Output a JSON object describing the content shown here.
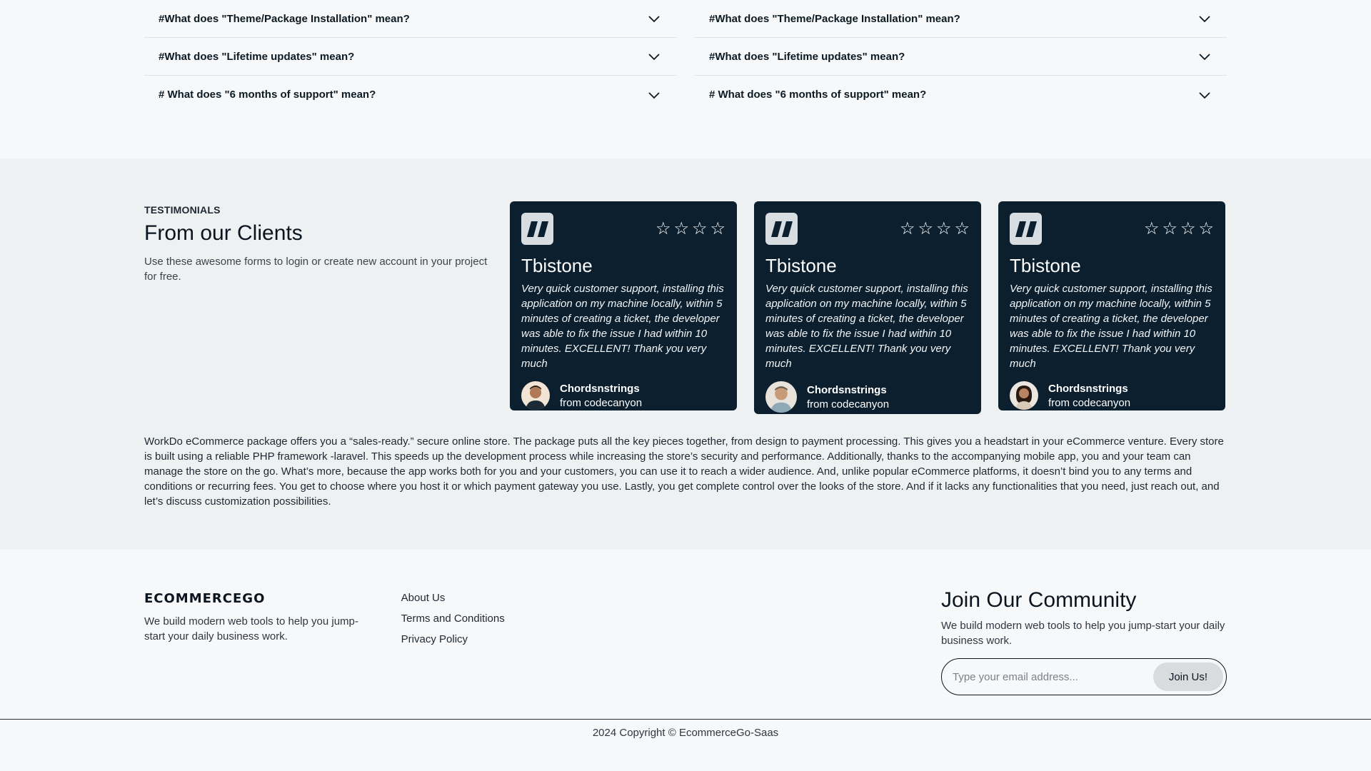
{
  "faq": {
    "left": [
      "#What does \"Theme/Package Installation\" mean?",
      "#What does \"Lifetime updates\" mean?",
      "# What does \"6 months of support\" mean?"
    ],
    "right": [
      "#What does \"Theme/Package Installation\" mean?",
      "#What does \"Lifetime updates\" mean?",
      "# What does \"6 months of support\" mean?"
    ]
  },
  "testimonials": {
    "kicker": "TESTIMONIALS",
    "title": "From our Clients",
    "description": "Use these awesome forms to login or create new account in your project for free.",
    "cards": [
      {
        "name": "Tbistone",
        "text": "Very quick customer support, installing this application on my machine locally, within 5 minutes of creating a ticket, the developer was able to fix the issue I had within 10 minutes. EXCELLENT! Thank you very much",
        "author": "Chordsnstrings",
        "source": "from codecanyon",
        "rating_icons": [
          "star-outline-icon",
          "star-outline-icon",
          "star-outline-icon",
          "star-outline-icon"
        ]
      },
      {
        "name": "Tbistone",
        "text": "Very quick customer support, installing this application on my machine locally, within 5 minutes of creating a ticket, the developer was able to fix the issue I had within 10 minutes. EXCELLENT! Thank you very much",
        "author": "Chordsnstrings",
        "source": "from codecanyon",
        "rating_icons": [
          "star-outline-icon",
          "star-outline-icon",
          "star-outline-icon",
          "star-outline-icon"
        ]
      },
      {
        "name": "Tbistone",
        "text": "Very quick customer support, installing this application on my machine locally, within 5 minutes of creating a ticket, the developer was able to fix the issue I had within 10 minutes. EXCELLENT! Thank you very much",
        "author": "Chordsnstrings",
        "source": "from codecanyon",
        "rating_icons": [
          "star-outline-icon",
          "star-outline-icon",
          "star-outline-icon",
          "star-outline-icon"
        ]
      }
    ],
    "about": "WorkDo eCommerce package offers you a “sales-ready.” secure online store. The package puts all the key pieces together, from design to payment processing. This gives you a headstart in your eCommerce venture. Every store is built using a reliable PHP framework -laravel. This speeds up the development process while increasing the store’s security and performance. Additionally, thanks to the accompanying mobile app, you and your team can manage the store on the go. What’s more, because the app works both for you and your customers, you can use it to reach a wider audience. And, unlike popular eCommerce platforms, it doesn’t bind you to any terms and conditions or recurring fees. You get to choose where you host it or which payment gateway you use. Lastly, you get complete control over the looks of the store. And if it lacks any functionalities that you need, just reach out, and let’s discuss customization possibilities."
  },
  "footer": {
    "logo_text": "ECOMMERCEGO",
    "brand_desc": "We build modern web tools to help you jump-start your daily business work.",
    "links": [
      "About Us",
      "Terms and Conditions",
      "Privacy Policy"
    ],
    "join_title": "Join Our Community",
    "join_desc": "We build modern web tools to help you jump-start your daily business work.",
    "email_placeholder": "Type your email address...",
    "join_button": "Join Us!",
    "copyright": "2024 Copyright © EcommerceGo-Saas"
  },
  "colors": {
    "card_bg": "#0b1f2e",
    "section_bg": "#eef1f1",
    "page_bg": "#f7f8fa"
  }
}
